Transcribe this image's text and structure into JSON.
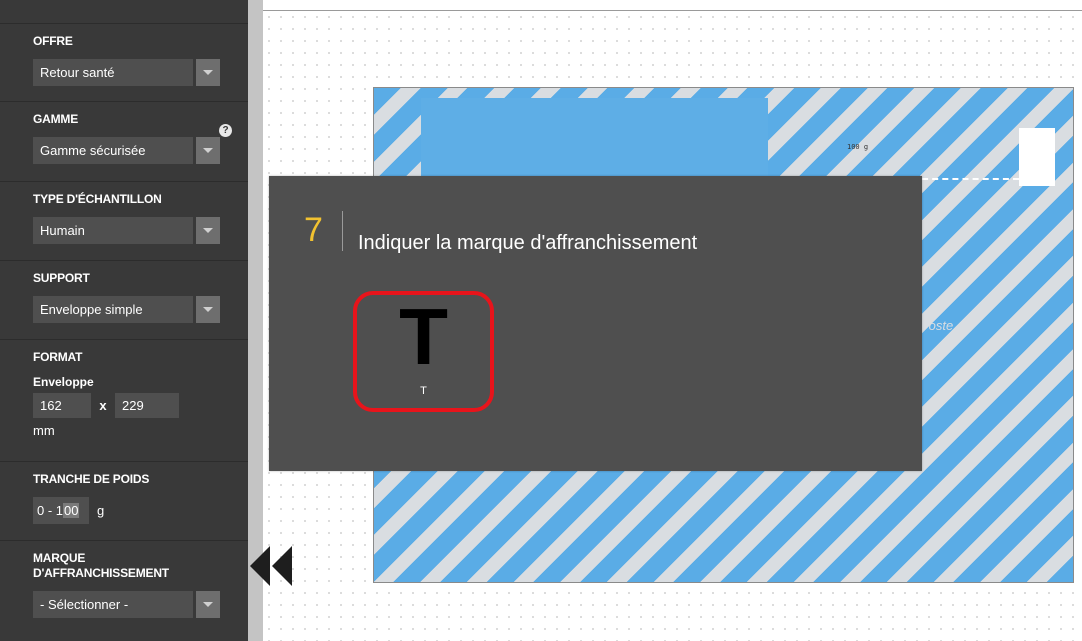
{
  "sidebar": {
    "offre": {
      "title": "OFFRE",
      "value": "Retour santé"
    },
    "gamme": {
      "title": "GAMME",
      "value": "Gamme sécurisée",
      "help": "?"
    },
    "type_echantillon": {
      "title": "TYPE D'ÉCHANTILLON",
      "value": "Humain"
    },
    "support": {
      "title": "SUPPORT",
      "value": "Enveloppe simple"
    },
    "format": {
      "title": "FORMAT",
      "sublabel": "Enveloppe",
      "width": "162",
      "x": "x",
      "height": "229",
      "unit": "mm"
    },
    "tranche_poids": {
      "title": "TRANCHE DE POIDS",
      "prefix": "0 - 1",
      "highlight": "00",
      "unit": "g"
    },
    "marque": {
      "title": "MARQUE D'AFFRANCHISSEMENT",
      "value": "- Sélectionner -"
    }
  },
  "envelope": {
    "weight_text": "100 g",
    "watermark": "Poste"
  },
  "popup": {
    "step_number": "7",
    "title": "Indiquer la marque d'affranchissement",
    "options": [
      {
        "glyph": "T",
        "label": "T"
      }
    ]
  },
  "colors": {
    "sidebar_bg": "#393939",
    "step_accent": "#f2c230",
    "selection_border": "#e8141b",
    "stripe_blue": "#5aace6"
  }
}
